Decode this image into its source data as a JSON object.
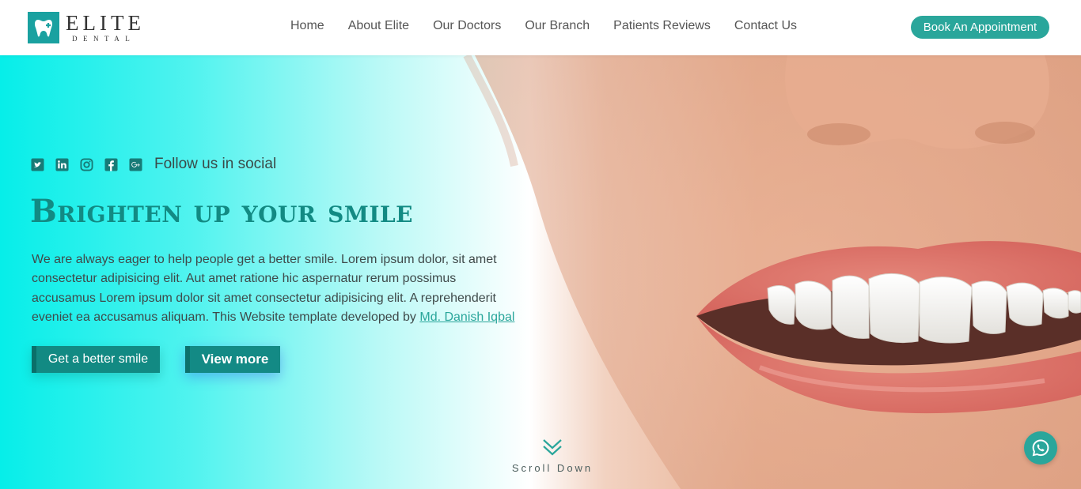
{
  "brand": {
    "name": "ELITE",
    "subtitle": "DENTAL"
  },
  "nav": [
    {
      "label": "Home"
    },
    {
      "label": "About Elite"
    },
    {
      "label": "Our Doctors"
    },
    {
      "label": "Our Branch"
    },
    {
      "label": "Patients Reviews"
    },
    {
      "label": "Contact Us"
    }
  ],
  "header": {
    "cta_label": "Book An Appointment"
  },
  "hero": {
    "social_icons": [
      "twitter-icon",
      "linkedin-icon",
      "instagram-icon",
      "facebook-icon",
      "google-plus-icon"
    ],
    "follow_text": "Follow us in social",
    "headline": "Brighten up your smile",
    "description": "We are always eager to help people get a better smile. Lorem ipsum dolor, sit amet consectetur adipisicing elit. Aut amet ratione hic aspernatur rerum possimus accusamus Lorem ipsum dolor sit amet consectetur adipisicing elit. A reprehenderit eveniet ea accusamus aliquam. This Website template developed by",
    "developer_link": "Md. Danish Iqbal",
    "primary_button": "Get a better smile",
    "secondary_button": "View more",
    "scroll_text": "Scroll Down"
  },
  "colors": {
    "accent": "#2aa69b",
    "headline": "#128a83",
    "hero_start": "#06eee9"
  }
}
